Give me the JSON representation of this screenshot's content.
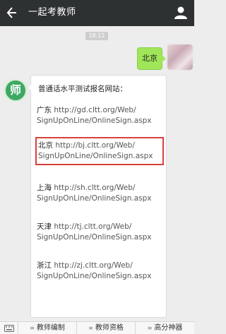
{
  "header": {
    "back_icon": "arrow-left-icon",
    "title": "一起考教师",
    "profile_icon": "person-icon"
  },
  "chat": {
    "time": "18:12",
    "sent_message": "北京",
    "bot_avatar_char": "师",
    "reply": {
      "intro": "普通话水平测试报名网站：",
      "sites": [
        {
          "city": "广东",
          "url_line1": "http://gd.cltt.org/Web/",
          "url_line2": "SignUpOnLine/OnlineSign.aspx",
          "highlighted": false
        },
        {
          "city": "北京",
          "url_line1": "http://bj.cltt.org/Web/",
          "url_line2": "SignUpOnLine/OnlineSign.aspx",
          "highlighted": true,
          "highlight_color": "#d9403b"
        },
        {
          "city": "上海",
          "url_line1": "http://sh.cltt.org/Web/",
          "url_line2": "SignUpOnLine/OnlineSign.aspx",
          "highlighted": false
        },
        {
          "city": "天津",
          "url_line1": "http://tj.cltt.org/Web/",
          "url_line2": "SignUpOnLine/OnlineSign.aspx",
          "highlighted": false
        },
        {
          "city": "浙江",
          "url_line1": "http://zj.cltt.org/Web/",
          "url_line2": "SignUpOnLine/OnlineSign.aspx",
          "highlighted": false
        }
      ]
    }
  },
  "menu": {
    "keyboard_icon": "keyboard-icon",
    "items": [
      "教师编制",
      "教师资格",
      "高分神器"
    ]
  },
  "colors": {
    "header_bg": "#2e3132",
    "sent_bubble": "#9fe658",
    "bot_avatar": "#3fa864"
  }
}
